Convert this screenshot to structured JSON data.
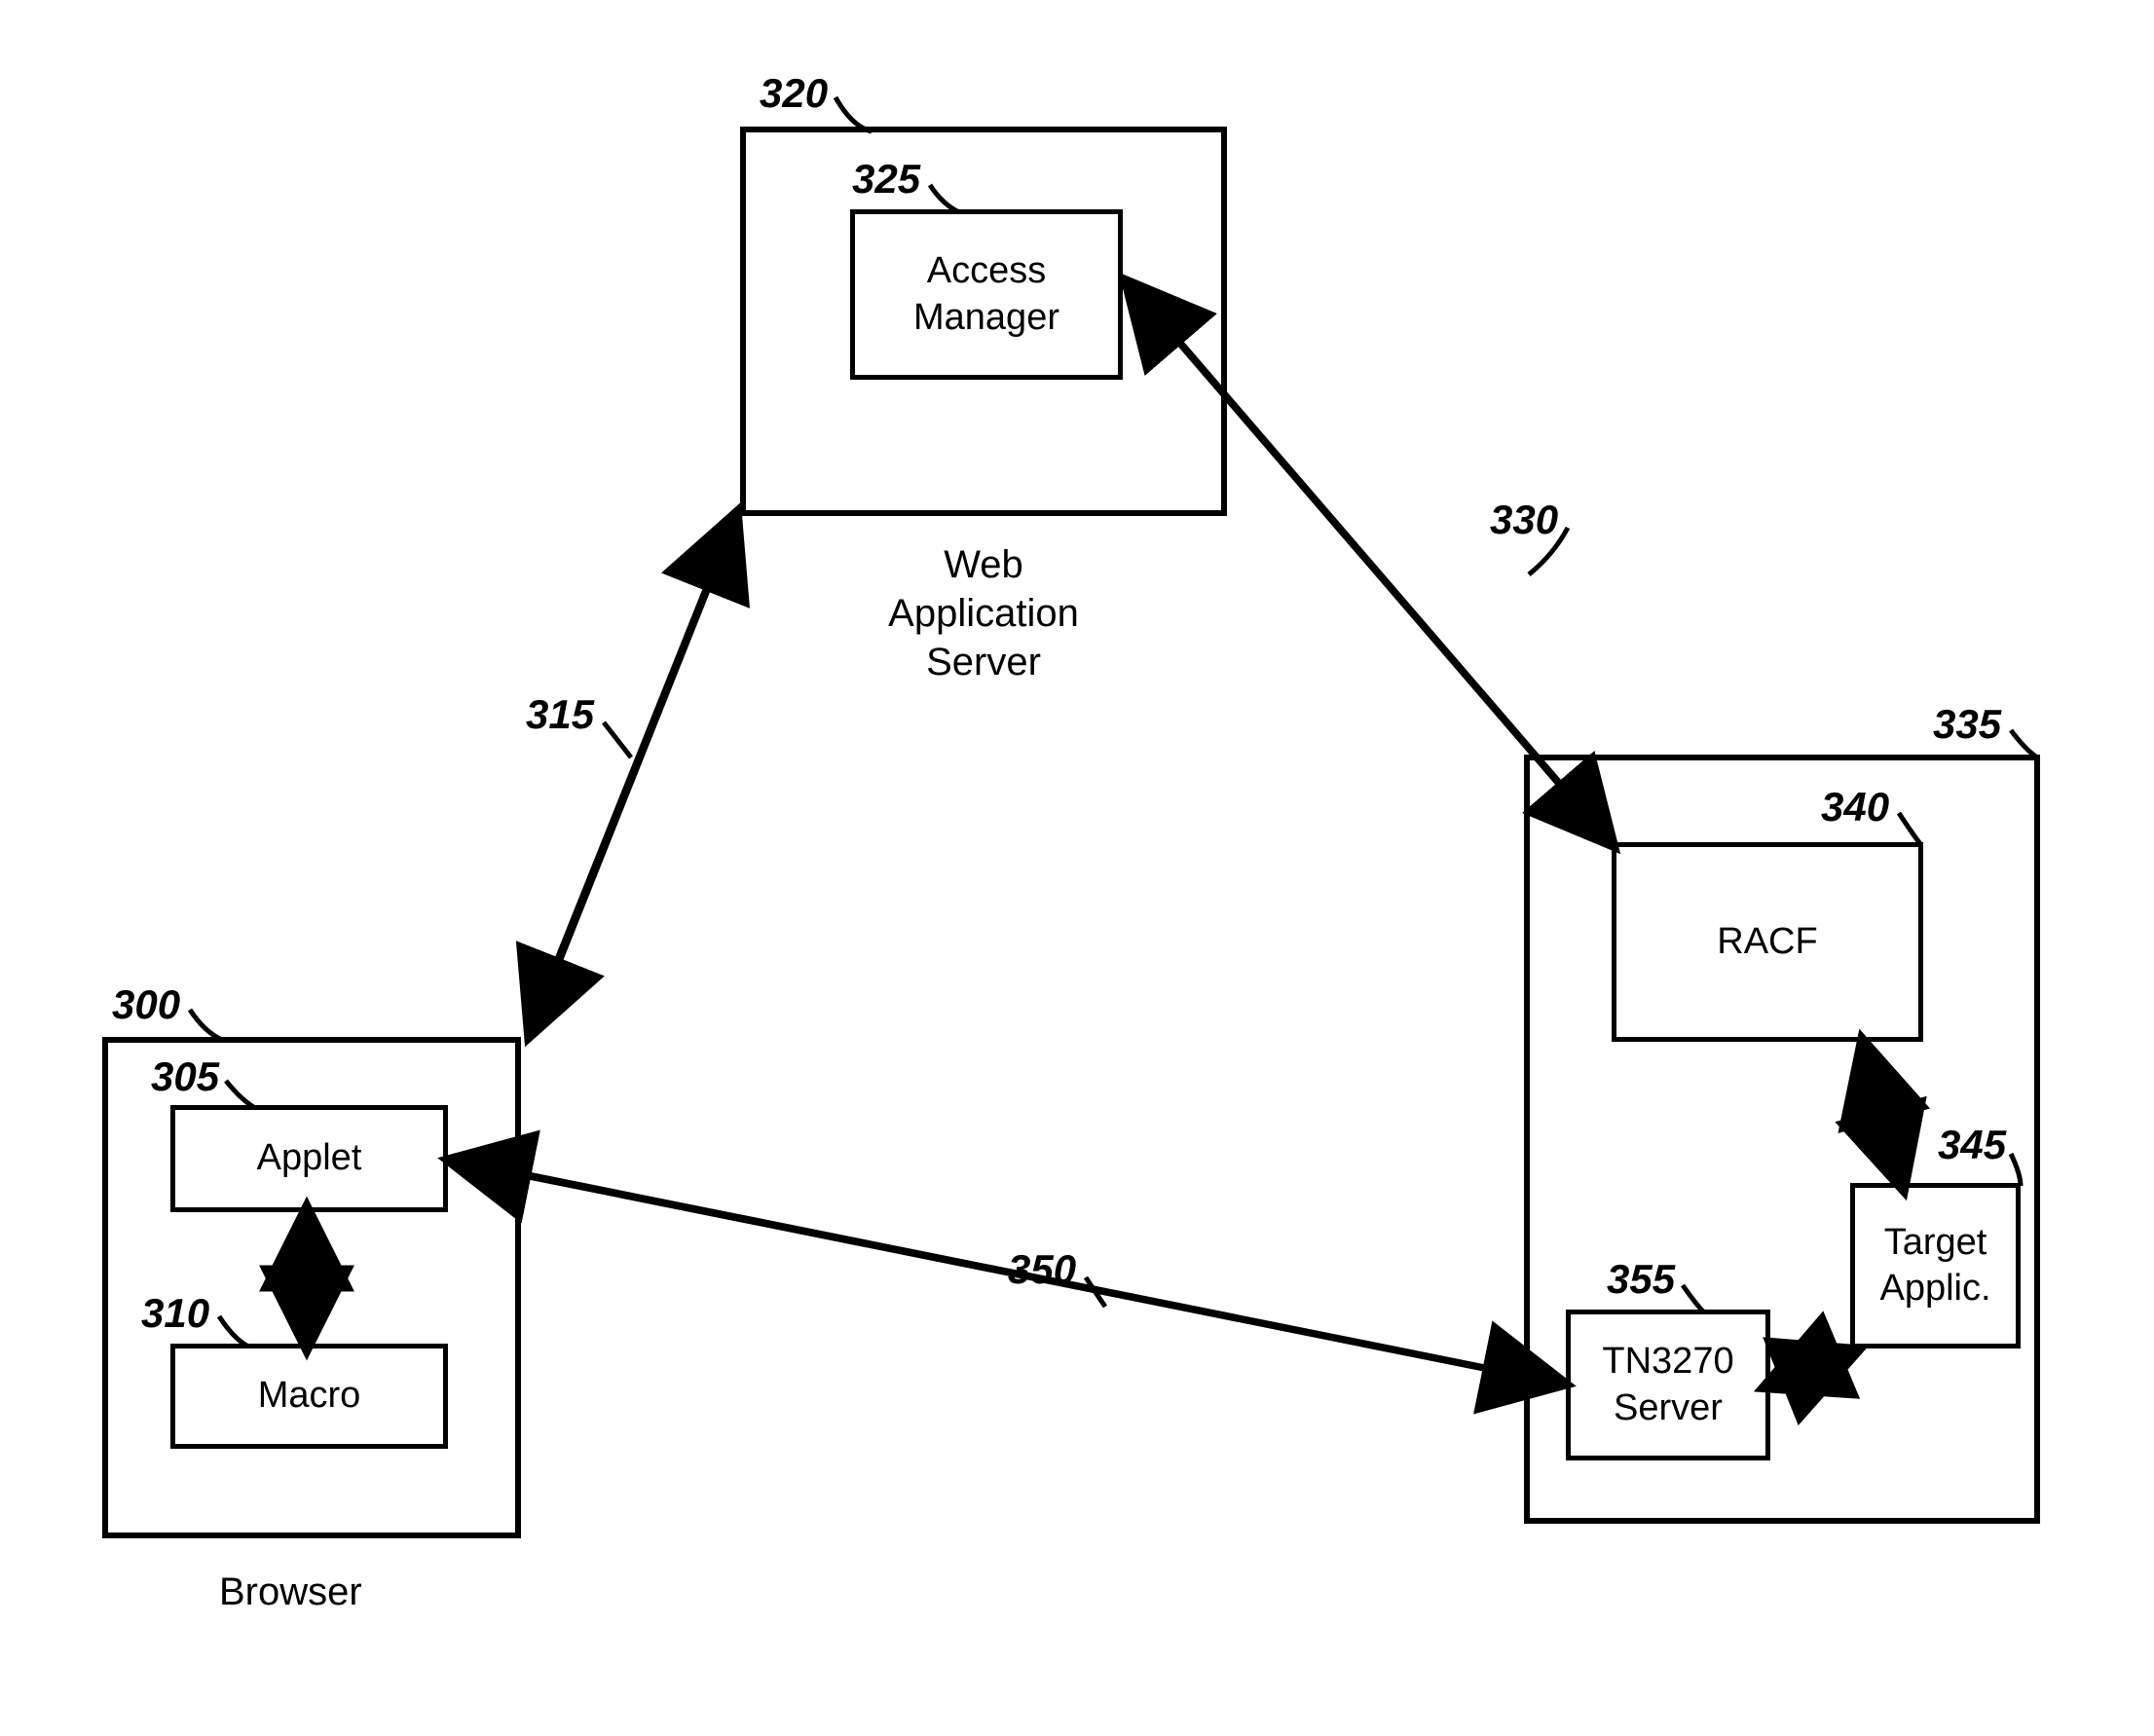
{
  "refs": {
    "browser": "300",
    "applet": "305",
    "macro": "310",
    "arrow_bw": "315",
    "webapp": "320",
    "access_mgr": "325",
    "arrow_wr": "330",
    "host": "335",
    "racf": "340",
    "target": "345",
    "arrow_at": "350",
    "tn3270": "355"
  },
  "labels": {
    "access_mgr": "Access\nManager",
    "webapp_caption": "Web\nApplication\nServer",
    "applet": "Applet",
    "macro": "Macro",
    "browser_caption": "Browser",
    "racf": "RACF",
    "target": "Target\nApplic.",
    "tn3270": "TN3270\nServer"
  }
}
